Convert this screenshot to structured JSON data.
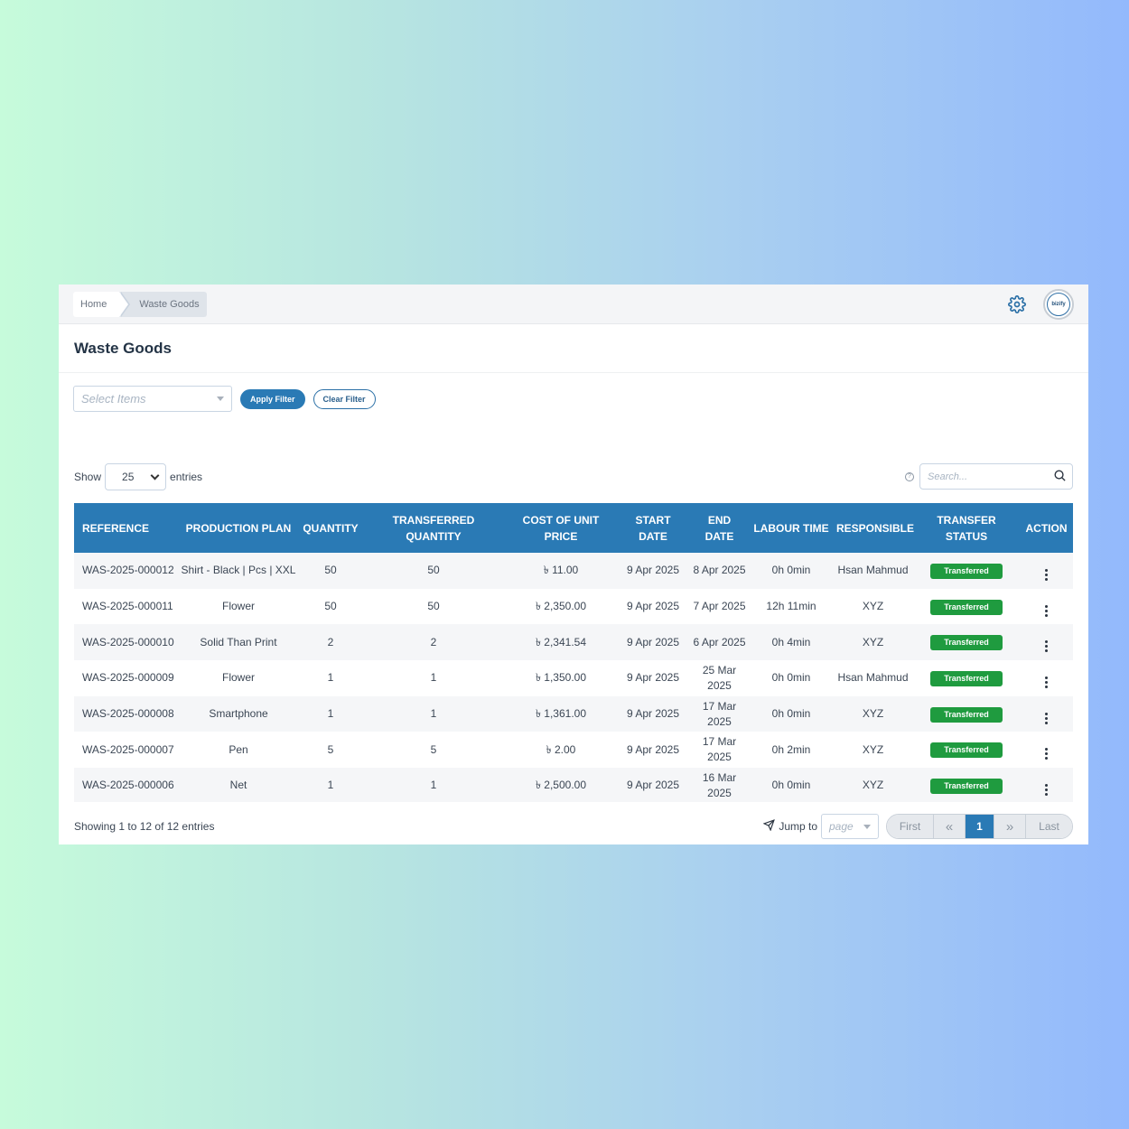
{
  "breadcrumb": {
    "home": "Home",
    "current": "Waste Goods"
  },
  "page": {
    "title": "Waste Goods"
  },
  "filter": {
    "select_placeholder": "Select Items",
    "apply_label": "Apply Filter",
    "clear_label": "Clear Filter"
  },
  "length": {
    "show_label": "Show",
    "value": "25",
    "entries_label": "entries"
  },
  "search": {
    "placeholder": "Search..."
  },
  "table": {
    "columns": [
      "Reference",
      "Production Plan",
      "Quantity",
      "Transferred Quantity",
      "Cost of Unit Price",
      "Start Date",
      "End Date",
      "Labour Time",
      "Responsible",
      "Transfer Status",
      "Action"
    ],
    "rows": [
      {
        "reference": "WAS-2025-000012",
        "plan": "Shirt - Black | Pcs | XXL",
        "quantity": "50",
        "transferred": "50",
        "cost": "৳ 11.00",
        "start": "9 Apr 2025",
        "end": "8 Apr 2025",
        "labour": "0h 0min",
        "responsible": "Hsan Mahmud",
        "status": "Transferred"
      },
      {
        "reference": "WAS-2025-000011",
        "plan": "Flower",
        "quantity": "50",
        "transferred": "50",
        "cost": "৳ 2,350.00",
        "start": "9 Apr 2025",
        "end": "7 Apr 2025",
        "labour": "12h 11min",
        "responsible": "XYZ",
        "status": "Transferred"
      },
      {
        "reference": "WAS-2025-000010",
        "plan": "Solid Than Print",
        "quantity": "2",
        "transferred": "2",
        "cost": "৳ 2,341.54",
        "start": "9 Apr 2025",
        "end": "6 Apr 2025",
        "labour": "0h 4min",
        "responsible": "XYZ",
        "status": "Transferred"
      },
      {
        "reference": "WAS-2025-000009",
        "plan": "Flower",
        "quantity": "1",
        "transferred": "1",
        "cost": "৳ 1,350.00",
        "start": "9 Apr 2025",
        "end": "25 Mar 2025",
        "labour": "0h 0min",
        "responsible": "Hsan Mahmud",
        "status": "Transferred"
      },
      {
        "reference": "WAS-2025-000008",
        "plan": "Smartphone",
        "quantity": "1",
        "transferred": "1",
        "cost": "৳ 1,361.00",
        "start": "9 Apr 2025",
        "end": "17 Mar 2025",
        "labour": "0h 0min",
        "responsible": "XYZ",
        "status": "Transferred"
      },
      {
        "reference": "WAS-2025-000007",
        "plan": "Pen",
        "quantity": "5",
        "transferred": "5",
        "cost": "৳ 2.00",
        "start": "9 Apr 2025",
        "end": "17 Mar 2025",
        "labour": "0h 2min",
        "responsible": "XYZ",
        "status": "Transferred"
      },
      {
        "reference": "WAS-2025-000006",
        "plan": "Net",
        "quantity": "1",
        "transferred": "1",
        "cost": "৳ 2,500.00",
        "start": "9 Apr 2025",
        "end": "16 Mar 2025",
        "labour": "0h 0min",
        "responsible": "XYZ",
        "status": "Transferred"
      }
    ]
  },
  "footer": {
    "info": "Showing 1 to 12 of 12 entries"
  },
  "pagination": {
    "jump_label": "Jump to",
    "page_placeholder": "page",
    "first": "First",
    "prev": "«",
    "current": "1",
    "next": "»",
    "last": "Last"
  },
  "avatar": {
    "text": "bizify"
  },
  "colors": {
    "header": "#2a7ab5",
    "status": "#1f9b3f"
  },
  "icons": {
    "settings": "gear-icon",
    "search": "search-icon",
    "send": "send-icon",
    "help": "help-icon"
  }
}
